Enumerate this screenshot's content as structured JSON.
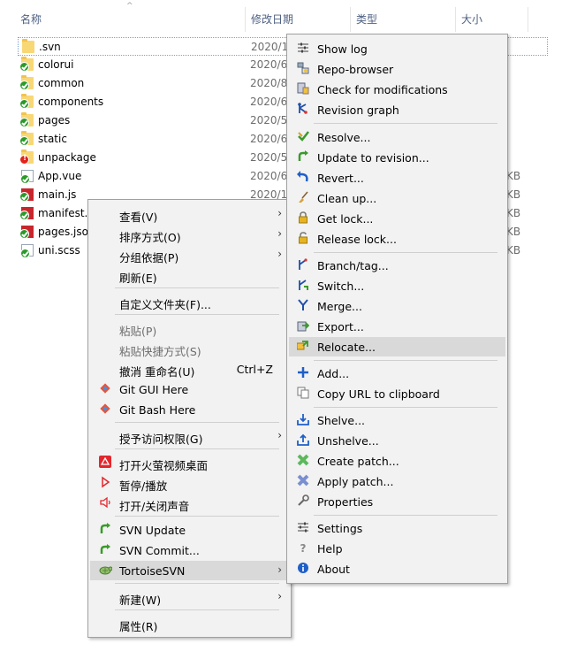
{
  "header": {
    "sort_arrow": "^",
    "columns": [
      "名称",
      "修改日期",
      "类型",
      "大小"
    ]
  },
  "files": [
    {
      "name": ".svn",
      "date": "2020/1",
      "size": "",
      "kind": "folder",
      "overlay": "none"
    },
    {
      "name": "colorui",
      "date": "2020/6",
      "size": "",
      "kind": "folder",
      "overlay": "ok"
    },
    {
      "name": "common",
      "date": "2020/8",
      "size": "",
      "kind": "folder",
      "overlay": "ok"
    },
    {
      "name": "components",
      "date": "2020/6",
      "size": "",
      "kind": "folder",
      "overlay": "ok"
    },
    {
      "name": "pages",
      "date": "2020/5",
      "size": "",
      "kind": "folder",
      "overlay": "ok"
    },
    {
      "name": "static",
      "date": "2020/6",
      "size": "",
      "kind": "folder",
      "overlay": "ok"
    },
    {
      "name": "unpackage",
      "date": "2020/5",
      "size": "",
      "kind": "folder",
      "overlay": "warn"
    },
    {
      "name": "App.vue",
      "date": "2020/6",
      "size": "KB",
      "kind": "file",
      "overlay": "ok"
    },
    {
      "name": "main.js",
      "date": "2020/1",
      "size": "KB",
      "kind": "filered",
      "overlay": "ok"
    },
    {
      "name": "manifest.j",
      "date": "",
      "size": "KB",
      "kind": "filered",
      "overlay": "ok"
    },
    {
      "name": "pages.jso",
      "date": "",
      "size": "KB",
      "kind": "filered",
      "overlay": "ok"
    },
    {
      "name": "uni.scss",
      "date": "",
      "size": "KB",
      "kind": "file",
      "overlay": "ok"
    }
  ],
  "context_menu": {
    "items": [
      {
        "label": "查看(V)",
        "arrow": "›"
      },
      {
        "label": "排序方式(O)",
        "arrow": "›"
      },
      {
        "label": "分组依据(P)",
        "arrow": "›"
      },
      {
        "label": "刷新(E)"
      },
      {
        "label": "自定义文件夹(F)..."
      },
      {
        "label": "粘贴(P)",
        "disabled": true
      },
      {
        "label": "粘贴快捷方式(S)",
        "disabled": true
      },
      {
        "label": "撤消 重命名(U)",
        "shortcut": "Ctrl+Z"
      },
      {
        "label": "Git GUI Here",
        "icon": "git-gui-icon"
      },
      {
        "label": "Git Bash Here",
        "icon": "git-bash-icon"
      },
      {
        "label": "授予访问权限(G)",
        "arrow": "›"
      },
      {
        "label": "打开火萤视频桌面",
        "icon": "huoying-icon"
      },
      {
        "label": "暂停/播放",
        "icon": "play-icon"
      },
      {
        "label": "打开/关闭声音",
        "icon": "speaker-icon"
      },
      {
        "label": "SVN Update",
        "icon": "svn-update-icon"
      },
      {
        "label": "SVN Commit...",
        "icon": "svn-commit-icon"
      },
      {
        "label": "TortoiseSVN",
        "icon": "tortoisesvn-icon",
        "arrow": "›"
      },
      {
        "label": "新建(W)",
        "arrow": "›"
      },
      {
        "label": "属性(R)"
      }
    ]
  },
  "svn_menu": {
    "items": [
      {
        "label": "Show log",
        "icon": "show-log-icon"
      },
      {
        "label": "Repo-browser",
        "icon": "repo-browser-icon"
      },
      {
        "label": "Check for modifications",
        "icon": "check-modifications-icon"
      },
      {
        "label": "Revision graph",
        "icon": "revision-graph-icon"
      },
      {
        "label": "Resolve...",
        "icon": "resolve-icon"
      },
      {
        "label": "Update to revision...",
        "icon": "update-revision-icon"
      },
      {
        "label": "Revert...",
        "icon": "revert-icon"
      },
      {
        "label": "Clean up...",
        "icon": "broom-icon"
      },
      {
        "label": "Get lock...",
        "icon": "lock-icon"
      },
      {
        "label": "Release lock...",
        "icon": "unlock-icon"
      },
      {
        "label": "Branch/tag...",
        "icon": "branch-icon"
      },
      {
        "label": "Switch...",
        "icon": "switch-icon"
      },
      {
        "label": "Merge...",
        "icon": "merge-icon"
      },
      {
        "label": "Export...",
        "icon": "export-icon"
      },
      {
        "label": "Relocate...",
        "icon": "relocate-icon"
      },
      {
        "label": "Add...",
        "icon": "add-icon"
      },
      {
        "label": "Copy URL to clipboard",
        "icon": "copy-url-icon"
      },
      {
        "label": "Shelve...",
        "icon": "shelve-icon"
      },
      {
        "label": "Unshelve...",
        "icon": "unshelve-icon"
      },
      {
        "label": "Create patch...",
        "icon": "create-patch-icon"
      },
      {
        "label": "Apply patch...",
        "icon": "apply-patch-icon"
      },
      {
        "label": "Properties",
        "icon": "wrench-icon"
      },
      {
        "label": "Settings",
        "icon": "settings-icon"
      },
      {
        "label": "Help",
        "icon": "help-icon"
      },
      {
        "label": "About",
        "icon": "info-icon"
      }
    ]
  },
  "colors": {
    "menu_bg": "#f2f2f2",
    "highlight": "#d9d9d9",
    "header_text": "#4d6082",
    "folder": "#f8d775",
    "ok_overlay": "#2a9a2a",
    "warn_overlay": "#e2231a"
  }
}
